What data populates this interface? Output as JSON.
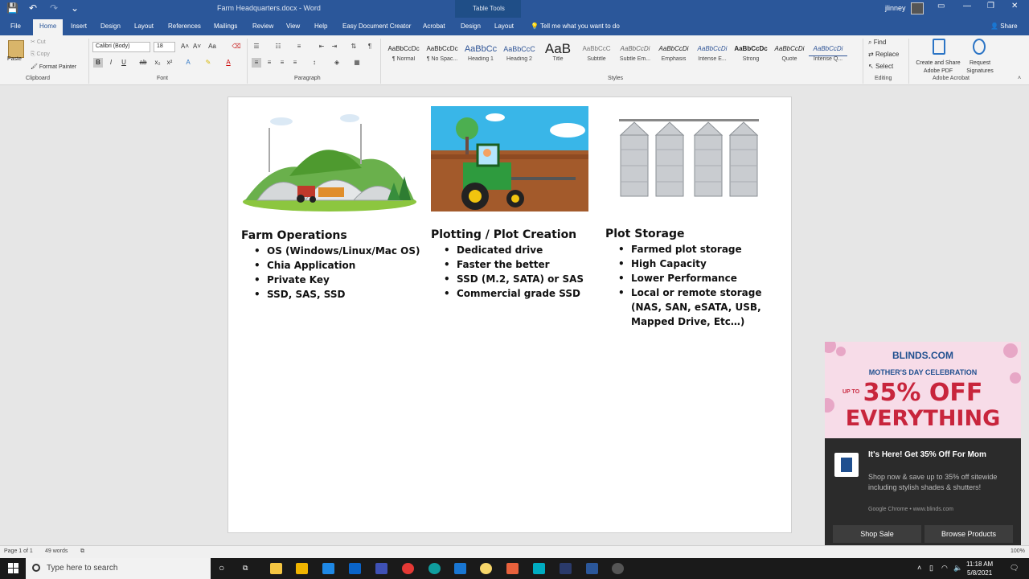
{
  "titlebar": {
    "doc_title": "Farm Headquarters.docx - Word",
    "table_tools": "Table Tools",
    "user": "jlinney",
    "minimize": "—",
    "restore": "❐",
    "close": "✕"
  },
  "tabs": [
    "File",
    "Home",
    "Insert",
    "Design",
    "Layout",
    "References",
    "Mailings",
    "Review",
    "View",
    "Help",
    "Easy Document Creator",
    "Acrobat",
    "Design",
    "Layout"
  ],
  "tell_me": "Tell me what you want to do",
  "share": "Share",
  "clipboard": {
    "paste": "Paste",
    "cut": "Cut",
    "copy": "Copy",
    "format_painter": "Format Painter",
    "label": "Clipboard"
  },
  "font": {
    "family": "Calibri (Body)",
    "size": "18",
    "label": "Font",
    "bold": "B",
    "italic": "I",
    "underline": "U",
    "strike": "ab",
    "sub": "x₂",
    "sup": "x²"
  },
  "paragraph": {
    "label": "Paragraph"
  },
  "styles": {
    "label": "Styles",
    "items": [
      {
        "sample": "AaBbCcDc",
        "name": "¶ Normal"
      },
      {
        "sample": "AaBbCcDc",
        "name": "¶ No Spac..."
      },
      {
        "sample": "AaBbCc",
        "name": "Heading 1"
      },
      {
        "sample": "AaBbCcC",
        "name": "Heading 2"
      },
      {
        "sample": "AaB",
        "name": "Title"
      },
      {
        "sample": "AaBbCcC",
        "name": "Subtitle"
      },
      {
        "sample": "AaBbCcDi",
        "name": "Subtle Em..."
      },
      {
        "sample": "AaBbCcDi",
        "name": "Emphasis"
      },
      {
        "sample": "AaBbCcDi",
        "name": "Intense E..."
      },
      {
        "sample": "AaBbCcDc",
        "name": "Strong"
      },
      {
        "sample": "AaBbCcDi",
        "name": "Quote"
      },
      {
        "sample": "AaBbCcDi",
        "name": "Intense Q..."
      }
    ]
  },
  "editing": {
    "find": "Find",
    "replace": "Replace",
    "select": "Select",
    "label": "Editing"
  },
  "acrobat": {
    "create": "Create and Share Adobe PDF",
    "request": "Request Signatures",
    "label": "Adobe Acrobat"
  },
  "document": {
    "columns": [
      {
        "heading": "Farm Operations",
        "items": [
          "OS (Windows/Linux/Mac OS)",
          "Chia Application",
          "Private Key",
          "SSD, SAS, SSD"
        ]
      },
      {
        "heading": "Plotting / Plot Creation",
        "items": [
          "Dedicated drive",
          "Faster the better",
          "SSD (M.2, SATA) or SAS",
          "Commercial grade SSD"
        ]
      },
      {
        "heading": "Plot Storage",
        "items": [
          "Farmed plot storage",
          "High Capacity",
          "Lower Performance",
          "Local or remote storage (NAS, SAN, eSATA, USB, Mapped Drive, Etc…)"
        ]
      }
    ]
  },
  "ad": {
    "brand": "BLINDS.COM",
    "line1": "MOTHER'S DAY CELEBRATION",
    "upto": "UP TO",
    "line2": "35% OFF",
    "line3": "EVERYTHING"
  },
  "toast": {
    "title": "It's Here! Get 35% Off For Mom",
    "body": "Shop now & save up to 35% off sitewide including stylish shades & shutters!",
    "source": "Google Chrome • www.blinds.com",
    "btn1": "Shop Sale",
    "btn2": "Browse Products"
  },
  "status": {
    "page": "Page 1 of 1",
    "words": "49 words",
    "zoom": "100%"
  },
  "taskbar": {
    "search": "Type here to search",
    "time": "11:18 AM",
    "date": "5/8/2021"
  }
}
